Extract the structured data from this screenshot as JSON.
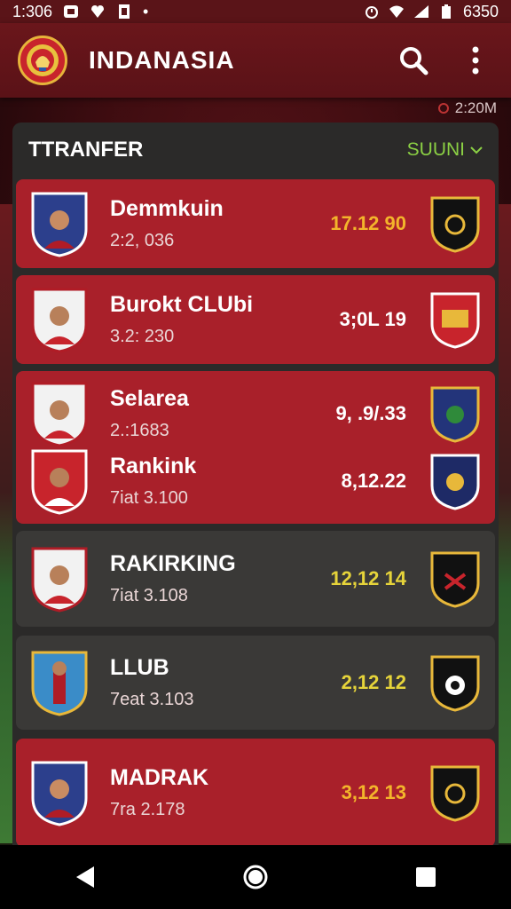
{
  "status_bar": {
    "time": "1:306",
    "battery_text": "6350"
  },
  "app_bar": {
    "title": "INDANASIA",
    "icons": [
      "search-icon",
      "more-vert-icon"
    ]
  },
  "update_text": "2:20M",
  "panel": {
    "title": "TTRANFER",
    "filter_label": "SUUNI"
  },
  "cards": [
    {
      "name": "Demmkuin",
      "sub": "2:2, 036",
      "value": "17.12 90"
    },
    {
      "name": "Burokt CLUbi",
      "sub": "3.2: 230",
      "value": "3;0L 19"
    },
    {
      "name": "Selarea",
      "sub": "2.:1683",
      "value": "9, .9/.33"
    },
    {
      "name": "Rankink",
      "sub": "7iat 3.100",
      "value": "8,12.22"
    },
    {
      "name": "RAKIRKING",
      "sub": "7iat 3.108",
      "value": "12,12 14"
    },
    {
      "name": "LLUB",
      "sub": "7eat 3.103",
      "value": "2,12 12"
    },
    {
      "name": "MADRAK",
      "sub": "7ra 2.178",
      "value": "3,12 13"
    }
  ],
  "colors": {
    "card_red": "#a9202a",
    "card_dark": "#3a3937",
    "accent_green": "#8bd044",
    "value_gold": "#f3b52b"
  }
}
